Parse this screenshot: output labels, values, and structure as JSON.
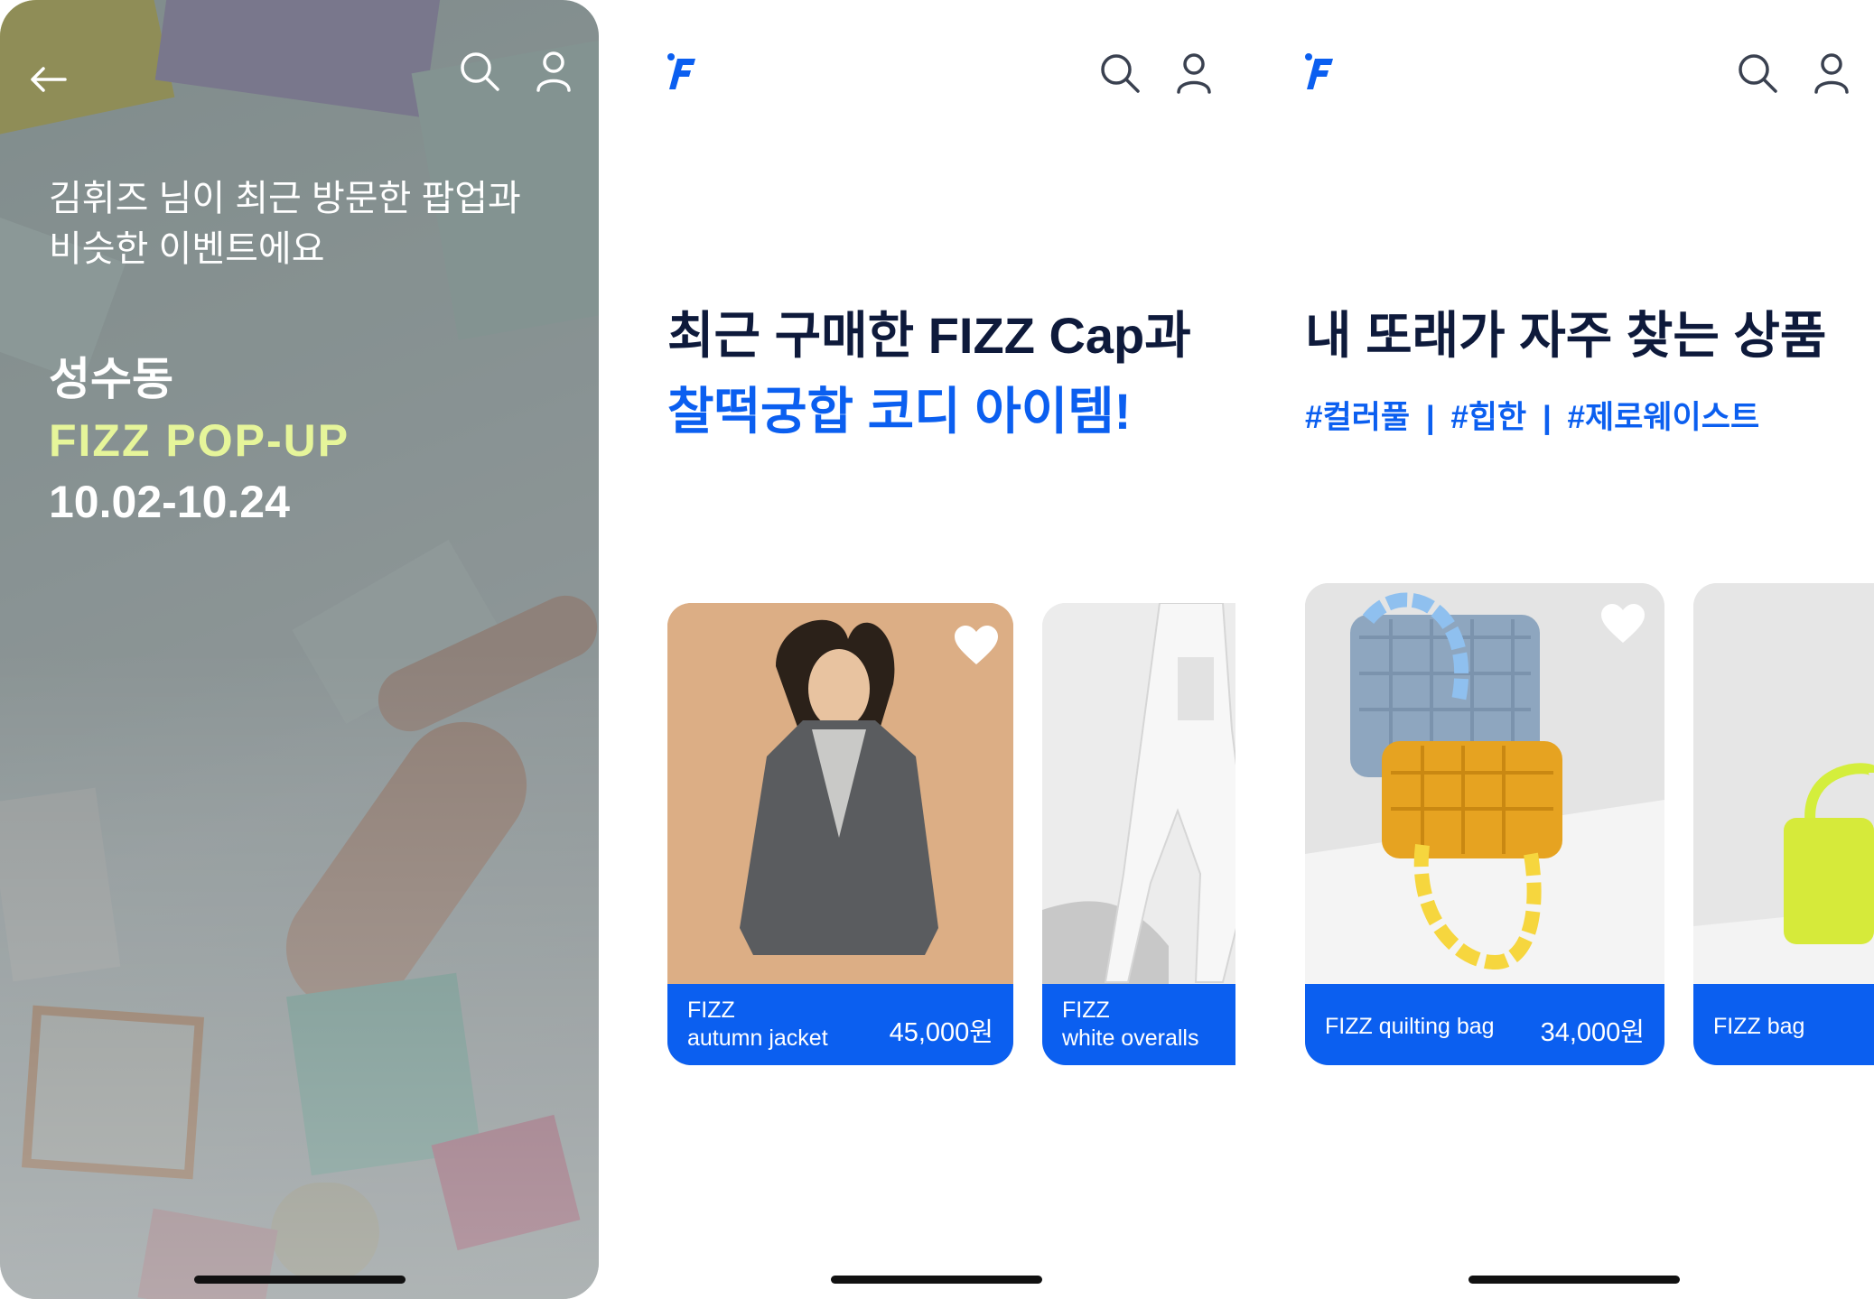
{
  "screen1": {
    "subtitle_line1": "김휘즈 님이 최근 방문한 팝업과",
    "subtitle_line2": "비슷한 이벤트에요",
    "location": "성수동",
    "event_name": "FIZZ POP-UP",
    "dates": "10.02-10.24",
    "icons": [
      "back-arrow-icon",
      "search-icon",
      "user-icon"
    ]
  },
  "screen2": {
    "heading_line1": "최근 구매한 FIZZ Cap과",
    "heading_line2": "찰떡궁합 코디 아이템!",
    "cards": [
      {
        "name_line1": "FIZZ",
        "name_line2": "autumn jacket",
        "price": "45,000원"
      },
      {
        "name_line1": "FIZZ",
        "name_line2": "white overalls"
      }
    ]
  },
  "screen3": {
    "heading": "내 또래가 자주 찾는 상품",
    "tags": [
      "#컬러풀",
      "|",
      "#힙한",
      "|",
      "#제로웨이스트"
    ],
    "cards": [
      {
        "name": "FIZZ quilting bag",
        "price": "34,000원"
      },
      {
        "name": "FIZZ bag"
      }
    ]
  },
  "colors": {
    "brand_blue": "#0b5ff0",
    "navy": "#0e1a3b",
    "lime": "#e6f59a"
  }
}
